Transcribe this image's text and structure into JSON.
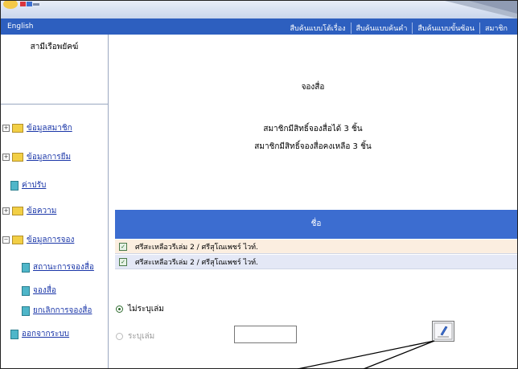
{
  "header": {
    "language_link": "English",
    "nav_links": [
      "สืบค้นแบบโต้เรื่อง",
      "สืบค้นแบบค้นคำ",
      "สืบค้นแบบขั้นซ้อน",
      "สมาชิก"
    ]
  },
  "sidebar": {
    "site_name": "สามีเรือพยัคฆ์",
    "items": [
      {
        "label": "ข้อมูลสมาชิก",
        "icon": "folder-icon",
        "expandable": true
      },
      {
        "label": "ข้อมูลการยืม",
        "icon": "folder-icon",
        "expandable": true
      },
      {
        "label": "ค่าปรับ",
        "icon": "document-icon",
        "expandable": false
      },
      {
        "label": "ข้อความ",
        "icon": "folder-icon",
        "expandable": true
      },
      {
        "label": "ข้อมูลการจอง",
        "icon": "folder-icon",
        "expandable": true,
        "expanded": true
      },
      {
        "label": "สถานะการจองสื่อ",
        "icon": "document-icon",
        "expandable": false
      },
      {
        "label": "จองสื่อ",
        "icon": "document-icon",
        "expandable": false
      },
      {
        "label": "ยกเลิกการจองสื่อ",
        "icon": "document-icon",
        "expandable": false
      },
      {
        "label": "ออกจากระบบ",
        "icon": "document-icon",
        "expandable": false
      }
    ]
  },
  "main": {
    "title": "จองสื่อ",
    "quota_text": "สมาชิกมีสิทธิ์จองสื่อได้ 3 ชิ้น",
    "remaining_text": "สมาชิกมีสิทธิ์จองสื่อคงเหลือ 3 ชิ้น",
    "table_header": "ชื่อ",
    "items": [
      {
        "title": "ศรีสะเหลือวรีเล่ม 2 / ศรีสุโณเพชร์ ไวท์.",
        "checked": true,
        "bg": "#fbeee0"
      },
      {
        "title": "ศรีสะเหลือวรีเล่ม 2 / ศรีสุโณเพชร์ ไวท์.",
        "checked": true,
        "bg": "#e4e8f6"
      }
    ],
    "option_no_volume": "ไม่ระบุเล่ม",
    "option_volume": "ระบุเล่ม",
    "volume_value": "",
    "selected_option": "no_volume"
  },
  "colors": {
    "navbar": "#2d5fbf",
    "table_header": "#3c6dd0",
    "link": "#1a36a8"
  }
}
